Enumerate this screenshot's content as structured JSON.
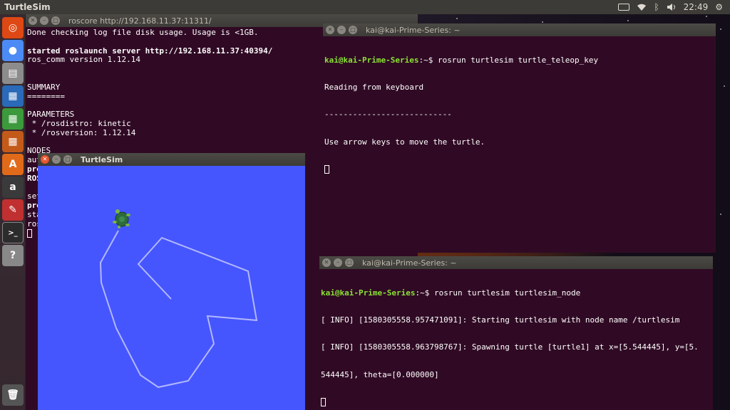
{
  "top_panel": {
    "app_title": "TurtleSim",
    "clock": "22:49"
  },
  "launcher": {
    "items": [
      {
        "name": "ubuntu-dash",
        "glyph": "◎",
        "color": "#dd4814"
      },
      {
        "name": "chrome",
        "glyph": "●",
        "color": "#4c8bf5"
      },
      {
        "name": "files",
        "glyph": "▤",
        "color": "#8c8c8c"
      },
      {
        "name": "writer",
        "glyph": "▦",
        "color": "#2a6ab8"
      },
      {
        "name": "calc",
        "glyph": "▦",
        "color": "#3c9a3c"
      },
      {
        "name": "impress",
        "glyph": "▦",
        "color": "#c45a1a"
      },
      {
        "name": "software-center",
        "glyph": "A",
        "color": "#e06a1a"
      },
      {
        "name": "amazon",
        "glyph": "a",
        "color": "#3a3a3a"
      },
      {
        "name": "settings",
        "glyph": "✎",
        "color": "#c03030"
      },
      {
        "name": "terminal",
        "glyph": ">_",
        "color": "#2c2c2c"
      },
      {
        "name": "help",
        "glyph": "?",
        "color": "#888888"
      },
      {
        "name": "trash",
        "glyph": "🗑",
        "color": "#555555"
      }
    ]
  },
  "roscore_window": {
    "title": "roscore http://192.168.11.37:11311/",
    "lines": [
      {
        "text": "Done checking log file disk usage. Usage is <1GB.",
        "bold": false
      },
      {
        "text": "",
        "bold": false
      },
      {
        "text": "started roslaunch server http://192.168.11.37:40394/",
        "bold": true
      },
      {
        "text": "ros_comm version 1.12.14",
        "bold": false
      },
      {
        "text": "",
        "bold": false
      },
      {
        "text": "",
        "bold": false
      },
      {
        "text": "SUMMARY",
        "bold": false
      },
      {
        "text": "========",
        "bold": false
      },
      {
        "text": "",
        "bold": false
      },
      {
        "text": "PARAMETERS",
        "bold": false
      },
      {
        "text": " * /rosdistro: kinetic",
        "bold": false
      },
      {
        "text": " * /rosversion: 1.12.14",
        "bold": false
      },
      {
        "text": "",
        "bold": false
      },
      {
        "text": "NODES",
        "bold": false
      },
      {
        "text": "auto",
        "bold": false
      },
      {
        "text": "proc",
        "bold": true
      },
      {
        "text": "ROS_",
        "bold": true
      },
      {
        "text": "",
        "bold": false
      },
      {
        "text": "sett",
        "bold": false
      },
      {
        "text": "proc",
        "bold": true
      },
      {
        "text": "star",
        "bold": false
      },
      {
        "text": "ros",
        "bold": false
      }
    ]
  },
  "teleop_window": {
    "title": "kai@kai-Prime-Series: ~",
    "prompt": "kai@kai-Prime-Series",
    "prompt_suffix": ":~$ rosrun turtlesim turtle_teleop_key",
    "lines": [
      "Reading from keyboard",
      "---------------------------",
      "Use arrow keys to move the turtle."
    ]
  },
  "node_window": {
    "title": "kai@kai-Prime-Series: ~",
    "prompt": "kai@kai-Prime-Series",
    "prompt_suffix": ":~$ rosrun turtlesim turtlesim_node",
    "lines": [
      "[ INFO] [1580305558.957471091]: Starting turtlesim with node name /turtlesim",
      "[ INFO] [1580305558.963798767]: Spawning turtle [turtle1] at x=[5.544445], y=[5.",
      "544445], theta=[0.000000]"
    ]
  },
  "turtlesim_window": {
    "title": "TurtleSim",
    "background": "#4556ff",
    "pen_color": "#b3b8ff"
  }
}
